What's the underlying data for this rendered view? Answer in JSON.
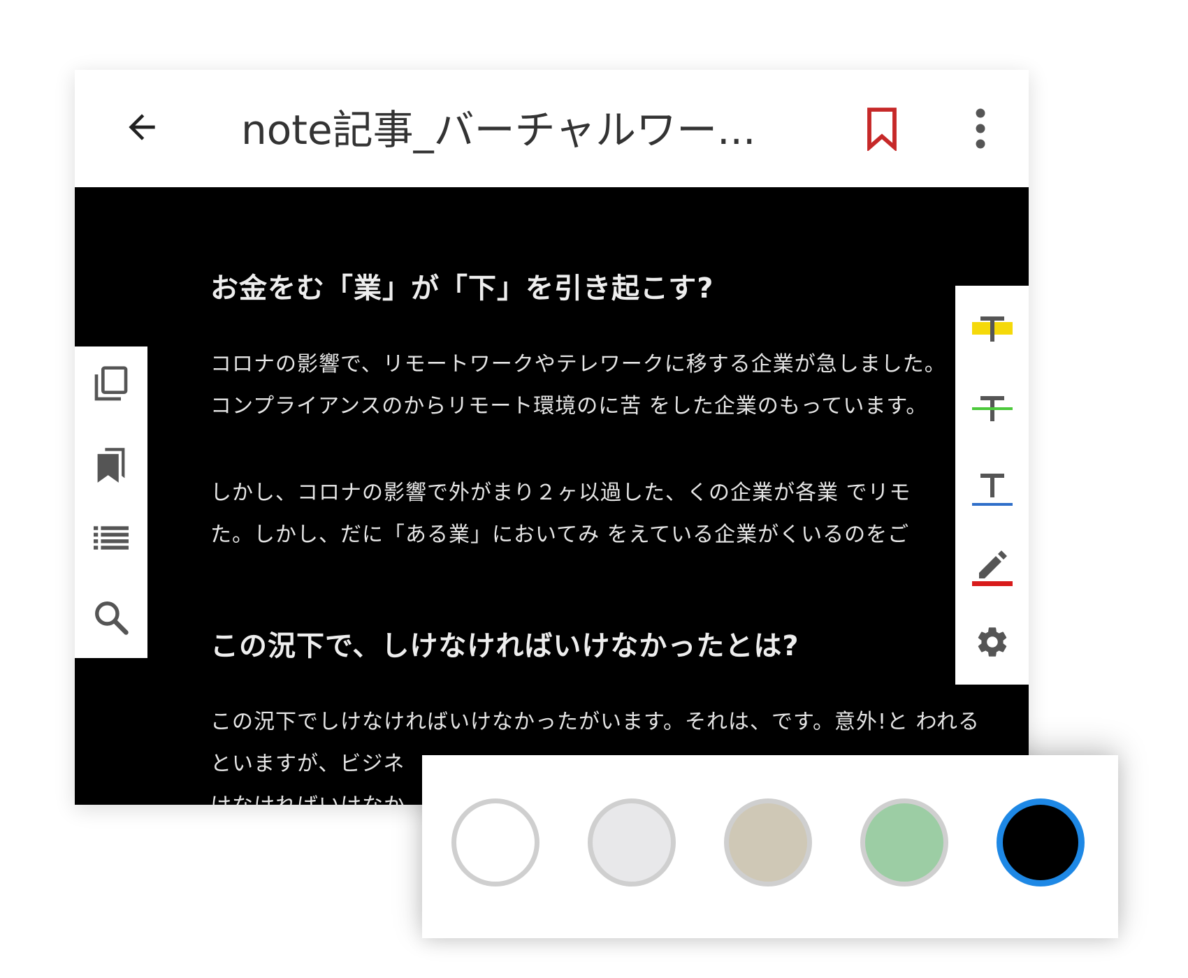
{
  "appbar": {
    "title": "note記事_バーチャルワー...",
    "back_icon": "arrow-left-icon",
    "bookmark_icon": "bookmark-outline-icon",
    "more_icon": "more-vertical-icon",
    "bookmark_color": "#c62828"
  },
  "article": {
    "heading1": "お金をむ「業」が「下」を引き起こす?",
    "p1_line1": "コロナの影響で、リモートワークやテレワークに移する企業が急しました。",
    "p1_line2": "コンプライアンスのからリモート環境のに苦 をした企業のもっています。",
    "p2_line1": "しかし、コロナの影響で外がまり２ヶ以過した、くの企業が各業 でリモ",
    "p2_line2": "た。しかし、だに「ある業」においてみ をえている企業がくいるのをご",
    "heading2": "この況下で、しけなければいけなかったとは?",
    "p3_line1": "この況下でしけなければいけなかったがいます。それは、です。意外!と われる",
    "p3_line2": "といますが、ビジネ",
    "p3_line3": "けなければいけなか"
  },
  "left_tools": [
    {
      "icon": "copy-pages-icon"
    },
    {
      "icon": "bookmarks-icon"
    },
    {
      "icon": "table-of-contents-icon"
    },
    {
      "icon": "search-icon"
    }
  ],
  "right_tools": [
    {
      "icon": "highlighter-yellow-icon",
      "color": "#f5d90a"
    },
    {
      "icon": "strikethrough-green-icon",
      "color": "#4cc93b"
    },
    {
      "icon": "underline-blue-icon",
      "color": "#2f6fc9"
    },
    {
      "icon": "pencil-red-icon",
      "color": "#d81b1b"
    },
    {
      "icon": "settings-gear-icon",
      "color": "#555555"
    }
  ],
  "background_colors": [
    {
      "fill": "#ffffff",
      "selected": false
    },
    {
      "fill": "#e8e8ea",
      "selected": false
    },
    {
      "fill": "#cfc8b6",
      "selected": false
    },
    {
      "fill": "#9ccda4",
      "selected": false
    },
    {
      "fill": "#000000",
      "selected": true
    }
  ],
  "colors": {
    "selection_ring": "#1e88e5",
    "swatch_ring": "#cfcfcf",
    "icon_gray": "#555555"
  }
}
